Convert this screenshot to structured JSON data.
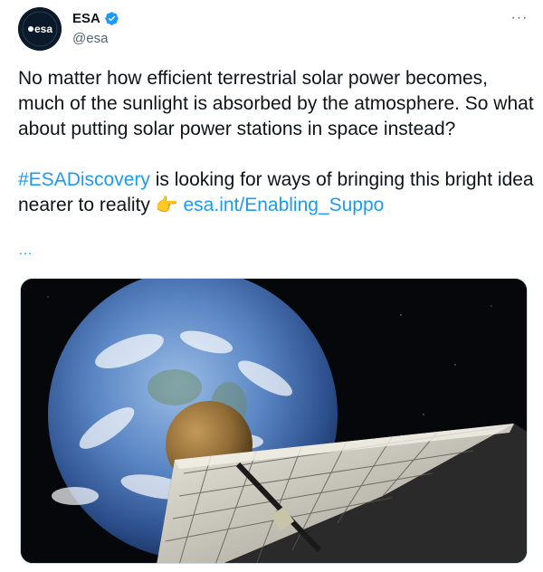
{
  "author": {
    "name": "ESA",
    "handle": "@esa",
    "avatar_text": "esa",
    "verified_icon": "verified-badge-icon",
    "verified_color": "#1d9bf0"
  },
  "tweet": {
    "para1": "No matter how efficient terrestrial solar power becomes, much of the sunlight is absorbed by the atmosphere. So what about putting solar power stations in space instead?",
    "hashtag": "#ESADiscovery",
    "para2_text": " is looking for ways of bringing this bright idea nearer to reality ",
    "pointing_emoji": "👉",
    "link": "esa.int/Enabling_Suppo",
    "truncation": "…"
  },
  "menu": {
    "more_icon": "more-dots-icon",
    "more_label": "···"
  },
  "media": {
    "description_icon": "space-solar-array-image"
  },
  "colors": {
    "link": "#1d9bf0",
    "text": "#0f1419",
    "secondary": "#536471"
  }
}
